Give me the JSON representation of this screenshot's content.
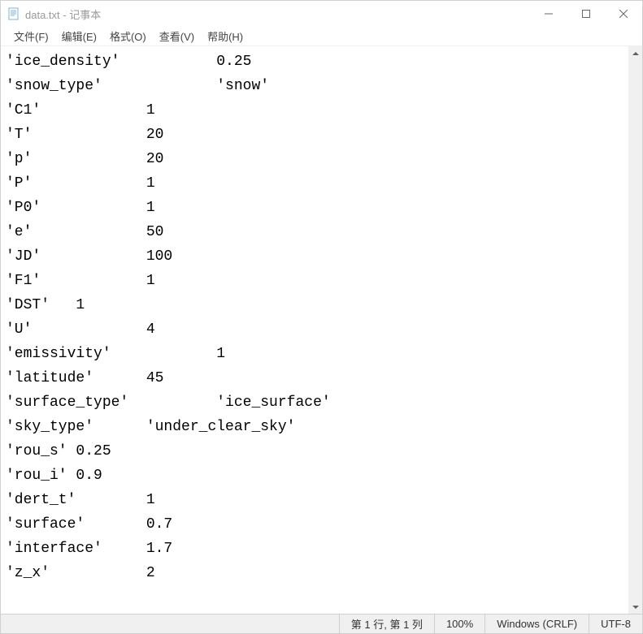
{
  "window": {
    "title": "data.txt - 记事本"
  },
  "menu": {
    "file": "文件(F)",
    "edit": "编辑(E)",
    "format": "格式(O)",
    "view": "查看(V)",
    "help": "帮助(H)"
  },
  "content": {
    "text": "'ice_density'\t\t0.25\n'snow_type'\t\t'snow'\n'C1'\t\t1\n'T'\t\t20\n'p'\t\t20\n'P'\t\t1\n'P0'\t\t1\n'e'\t\t50\n'JD'\t\t100\n'F1'\t\t1\n'DST'\t1\n'U'\t\t4\n'emissivity'\t\t1\n'latitude'\t45\n'surface_type'\t\t'ice_surface'\n'sky_type'\t'under_clear_sky'\n'rou_s'\t0.25\n'rou_i'\t0.9\n'dert_t'\t1\n'surface'\t0.7\n'interface'\t1.7\n'z_x'\t\t2"
  },
  "status": {
    "position": "第 1 行, 第 1 列",
    "zoom": "100%",
    "line_ending": "Windows (CRLF)",
    "encoding": "UTF-8"
  }
}
